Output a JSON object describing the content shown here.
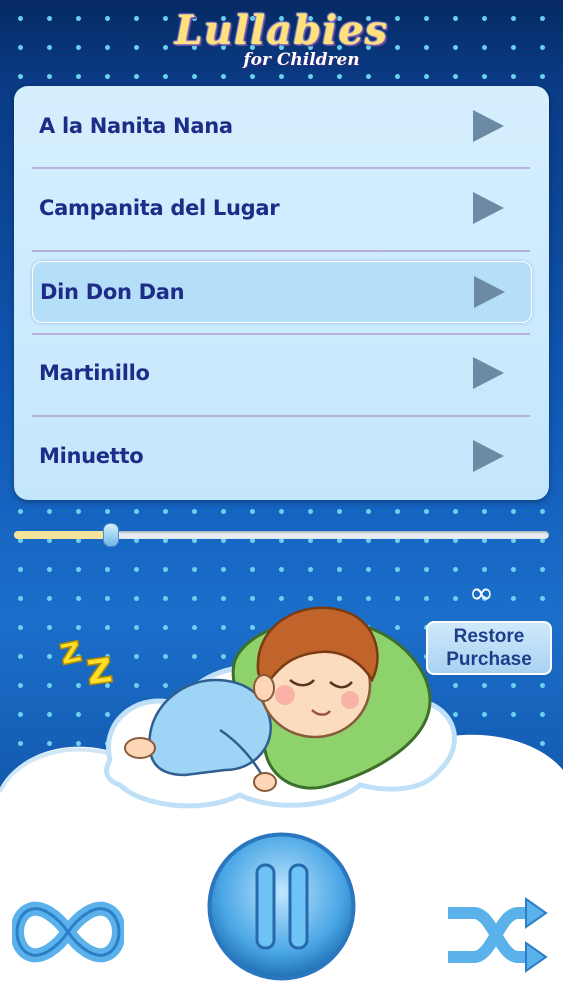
{
  "logo": {
    "title": "Lullabies",
    "subtitle": "for Children"
  },
  "playlist": {
    "items": [
      {
        "label": "A la Nanita Nana"
      },
      {
        "label": "Campanita del Lugar"
      },
      {
        "label": "Din Don Dan",
        "selected": true
      },
      {
        "label": "Martinillo"
      },
      {
        "label": "Minuetto"
      }
    ]
  },
  "player": {
    "progress_fraction": 0.18,
    "repeat_symbol": "∞",
    "restore_line1": "Restore",
    "restore_line2": "Purchase",
    "icons": {
      "play": "play-icon",
      "pause": "pause-icon",
      "loop": "infinity-loop-icon",
      "shuffle": "shuffle-icon",
      "sleep": "zzz-icon"
    }
  },
  "colors": {
    "list_text": "#1d2d87",
    "accent_yellow": "#f6e39a",
    "play_arrow": "#6d8aa5"
  }
}
